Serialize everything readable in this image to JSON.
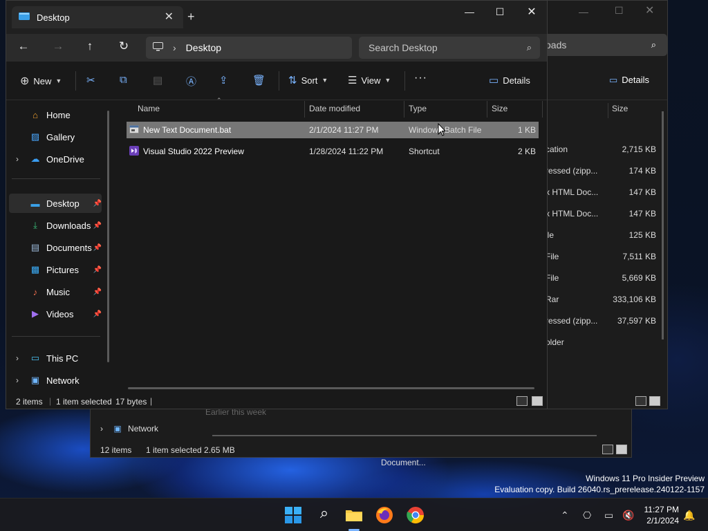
{
  "watermark": {
    "line1": "Windows 11 Pro Insider Preview",
    "line2": "Evaluation copy. Build 26040.rs_prerelease.240122-1157"
  },
  "back_window_2": {
    "nav_network": "Network",
    "group_label": "Earlier this week",
    "status_items": "12 items",
    "status_selected": "1 item selected  2.65 MB",
    "desktop_label": "Document..."
  },
  "back_window_1": {
    "search_placeholder": "oads",
    "details_label": "Details",
    "size_header": "Size",
    "rows": [
      {
        "type": "cation",
        "size": "2,715 KB"
      },
      {
        "type": "ressed (zipp...",
        "size": "174 KB"
      },
      {
        "type": "x HTML Doc...",
        "size": "147 KB"
      },
      {
        "type": "x HTML Doc...",
        "size": "147 KB"
      },
      {
        "type": "ile",
        "size": "125 KB"
      },
      {
        "type": "File",
        "size": "7,511 KB"
      },
      {
        "type": "File",
        "size": "5,669 KB"
      },
      {
        "type": "Rar",
        "size": "333,106 KB"
      },
      {
        "type": "ressed (zipp...",
        "size": "37,597 KB"
      },
      {
        "type": "older",
        "size": ""
      }
    ]
  },
  "window": {
    "tab_title": "Desktop",
    "breadcrumb": "Desktop",
    "search_placeholder": "Search Desktop",
    "toolbar": {
      "new": "New",
      "sort": "Sort",
      "view": "View",
      "more": "···",
      "details": "Details"
    },
    "sidebar": {
      "home": "Home",
      "gallery": "Gallery",
      "onedrive": "OneDrive",
      "desktop": "Desktop",
      "downloads": "Downloads",
      "documents": "Documents",
      "pictures": "Pictures",
      "music": "Music",
      "videos": "Videos",
      "thispc": "This PC",
      "network": "Network"
    },
    "columns": {
      "name": "Name",
      "date": "Date modified",
      "type": "Type",
      "size": "Size"
    },
    "files": [
      {
        "name": "New Text Document.bat",
        "date": "2/1/2024 11:27 PM",
        "type": "Windows Batch File",
        "size": "1 KB"
      },
      {
        "name": "Visual Studio 2022 Preview",
        "date": "1/28/2024 11:22 PM",
        "type": "Shortcut",
        "size": "2 KB"
      }
    ],
    "status": {
      "items": "2 items",
      "selected": "1 item selected",
      "bytes": "17 bytes"
    }
  },
  "taskbar": {
    "time": "11:27 PM",
    "date": "2/1/2024"
  },
  "colors": {
    "accent": "#7ab4ff",
    "selection": "#777777",
    "window_bg": "#191919"
  }
}
